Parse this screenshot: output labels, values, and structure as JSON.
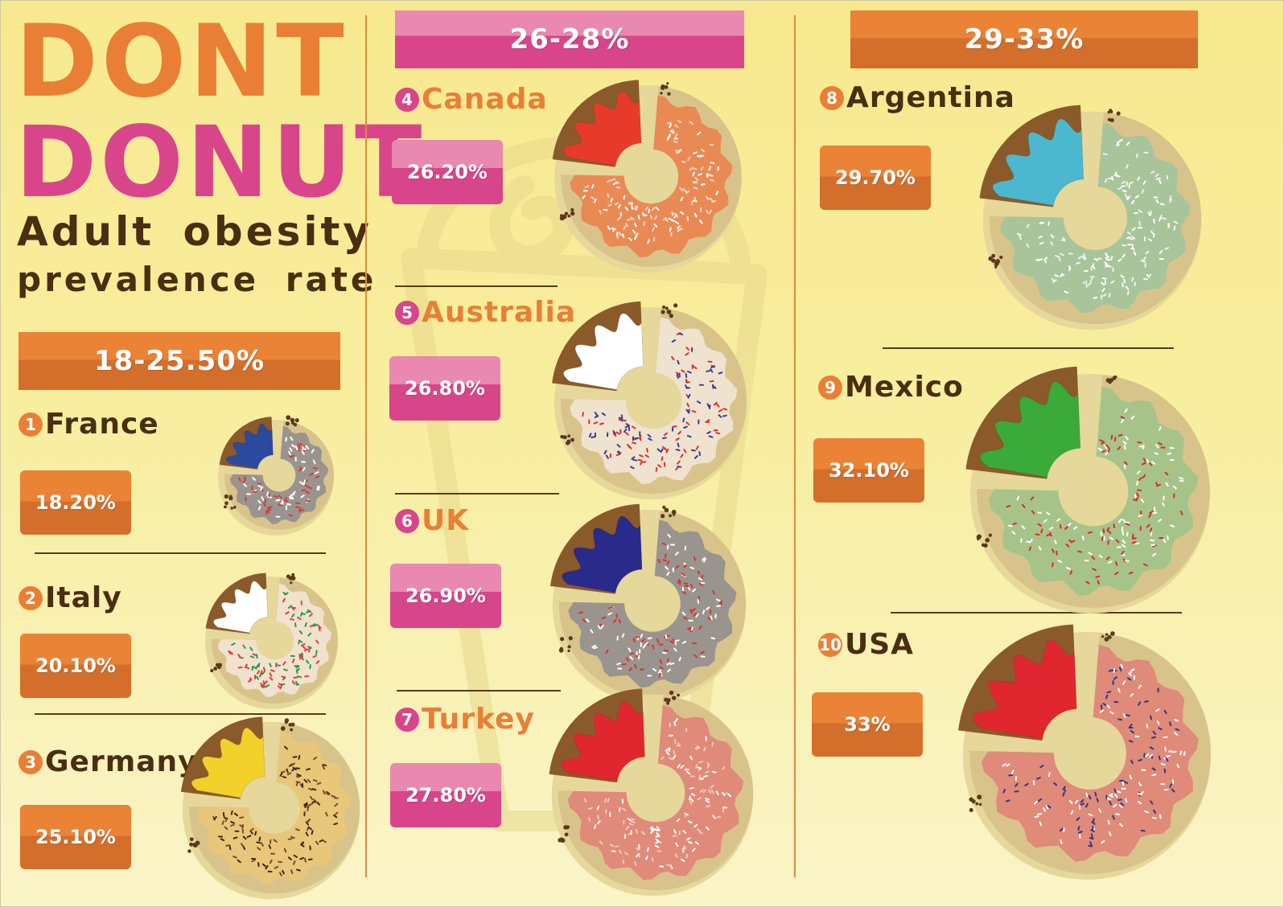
{
  "title": {
    "line1": "DONT",
    "line2": "DONUT"
  },
  "subtitle": {
    "line1": "Adult obesity",
    "line2": "prevalence rate"
  },
  "colors": {
    "orange": "#e97f35",
    "pink": "#d9458a",
    "brown": "#4a2e12",
    "dough": "#d8c48a",
    "chocolate": "#8a5a2a"
  },
  "bands": [
    {
      "label": "18-25.50%",
      "color": "orange"
    },
    {
      "label": "26-28%",
      "color": "pink"
    },
    {
      "label": "29-33%",
      "color": "orange"
    }
  ],
  "chart_data": {
    "type": "bar",
    "title": "Adult obesity prevalence rate",
    "categories": [
      "France",
      "Italy",
      "Germany",
      "Canada",
      "Australia",
      "UK",
      "Turkey",
      "Argentina",
      "Mexico",
      "USA"
    ],
    "values": [
      18.2,
      20.1,
      25.1,
      26.2,
      26.8,
      26.9,
      27.8,
      29.7,
      32.1,
      33
    ],
    "ranks": [
      "1",
      "2",
      "3",
      "4",
      "5",
      "6",
      "7",
      "8",
      "9",
      "10"
    ],
    "value_labels": [
      "18.20%",
      "20.10%",
      "25.10%",
      "26.20%",
      "26.80%",
      "26.90%",
      "27.80%",
      "29.70%",
      "32.10%",
      "33%"
    ],
    "icing_colors": [
      "#2b4a9e",
      "#ffffff",
      "#f2d22a",
      "#e83a2a",
      "#ffffff",
      "#2a2a8a",
      "#e0262e",
      "#4bb8d0",
      "#3aaa3a",
      "#e0262e"
    ],
    "ring_colors": [
      "#9a948e",
      "#f0e2cf",
      "#e8c77a",
      "#e98a55",
      "#efe3cf",
      "#9a948e",
      "#e08a7a",
      "#a8c49a",
      "#a6c48a",
      "#e08a7a"
    ],
    "sprinkle_colors": [
      [
        "#d93a3a",
        "#ffffff"
      ],
      [
        "#e83a3a",
        "#2a9a4a"
      ],
      [
        "#3a2a1a",
        "#7a4a2a"
      ],
      [
        "#ffffff",
        "#f6d2b8"
      ],
      [
        "#e0302a",
        "#3a3a9a"
      ],
      [
        "#ffffff",
        "#e0302a"
      ],
      [
        "#ffffff",
        "#f2c8b8"
      ],
      [
        "#ffffff",
        "#f0f0f0"
      ],
      [
        "#e0262e",
        "#ffffff"
      ],
      [
        "#ffffff",
        "#2a3a8a"
      ]
    ]
  }
}
